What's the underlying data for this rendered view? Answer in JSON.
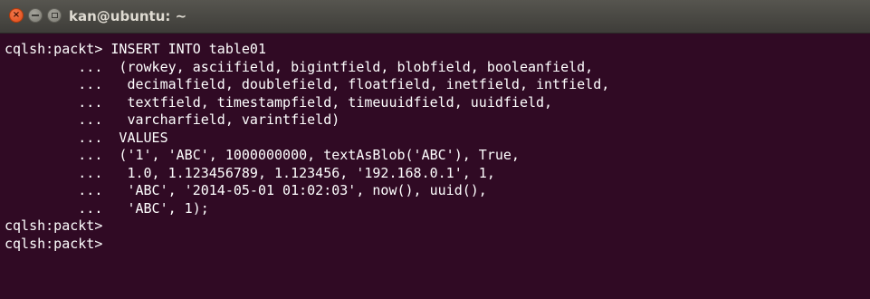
{
  "window": {
    "title": "kan@ubuntu: ~",
    "close_glyph": "×",
    "colors": {
      "terminal_bg": "#300a24",
      "text": "#ffffff",
      "close_button": "#df4a16"
    }
  },
  "terminal": {
    "lines": [
      "cqlsh:packt> INSERT INTO table01",
      "         ...  (rowkey, asciifield, bigintfield, blobfield, booleanfield,",
      "         ...   decimalfield, doublefield, floatfield, inetfield, intfield,",
      "         ...   textfield, timestampfield, timeuuidfield, uuidfield,",
      "         ...   varcharfield, varintfield)",
      "         ...  VALUES",
      "         ...  ('1', 'ABC', 1000000000, textAsBlob('ABC'), True,",
      "         ...   1.0, 1.123456789, 1.123456, '192.168.0.1', 1,",
      "         ...   'ABC', '2014-05-01 01:02:03', now(), uuid(),",
      "         ...   'ABC', 1);",
      "cqlsh:packt>",
      "cqlsh:packt>"
    ]
  }
}
